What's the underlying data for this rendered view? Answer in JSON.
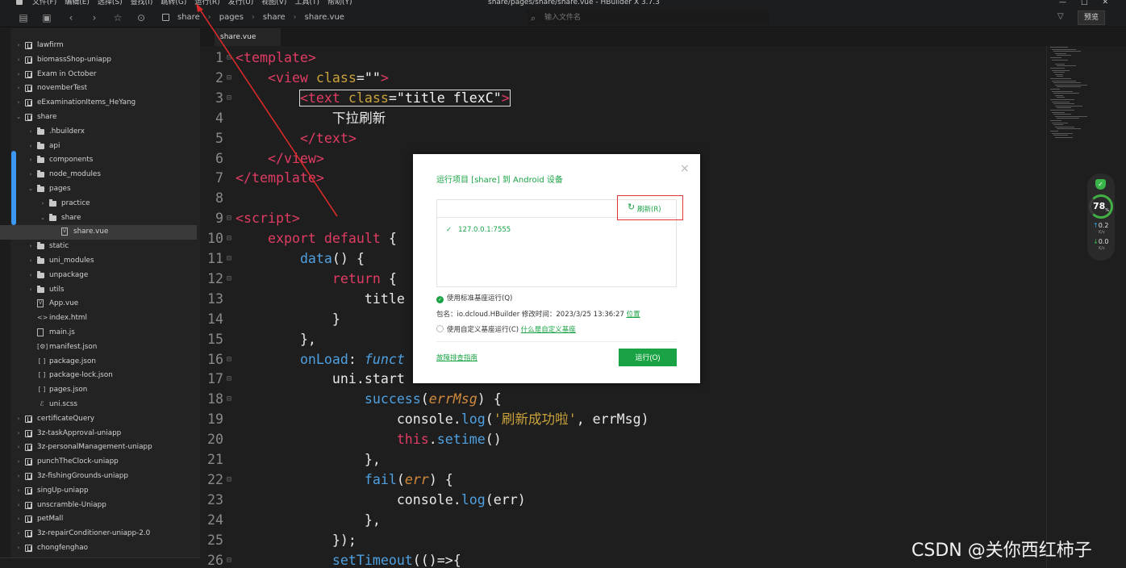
{
  "menubar": {
    "menus": [
      "文件(F)",
      "编辑(E)",
      "选择(S)",
      "查找(I)",
      "跳转(G)",
      "运行(R)",
      "发行(U)",
      "视图(V)",
      "工具(T)",
      "帮助(Y)"
    ],
    "window_title": "share/pages/share/share.vue - HBuilder X 3.7.3",
    "minimize": "—",
    "maximize": "□",
    "close": "✕"
  },
  "toolbar": {
    "breadcrumbs": [
      "share",
      "pages",
      "share",
      "share.vue"
    ],
    "search_placeholder": "输入文件名",
    "preview_label": "预览"
  },
  "sidebar": {
    "items": [
      {
        "label": "lawfirm",
        "depth": 0,
        "type": "project",
        "expanded": false
      },
      {
        "label": "biomassShop-uniapp",
        "depth": 0,
        "type": "project",
        "expanded": false
      },
      {
        "label": "Exam in October",
        "depth": 0,
        "type": "project",
        "expanded": false
      },
      {
        "label": "novemberTest",
        "depth": 0,
        "type": "project",
        "expanded": false
      },
      {
        "label": "eExaminationItems_HeYang",
        "depth": 0,
        "type": "project",
        "expanded": false
      },
      {
        "label": "share",
        "depth": 0,
        "type": "project",
        "expanded": true
      },
      {
        "label": ".hbuilderx",
        "depth": 1,
        "type": "folder",
        "expanded": false
      },
      {
        "label": "api",
        "depth": 1,
        "type": "folder",
        "expanded": false
      },
      {
        "label": "components",
        "depth": 1,
        "type": "folder",
        "expanded": false
      },
      {
        "label": "node_modules",
        "depth": 1,
        "type": "folder",
        "expanded": false
      },
      {
        "label": "pages",
        "depth": 1,
        "type": "folder",
        "expanded": true
      },
      {
        "label": "practice",
        "depth": 2,
        "type": "folder",
        "expanded": false
      },
      {
        "label": "share",
        "depth": 2,
        "type": "folder",
        "expanded": true
      },
      {
        "label": "share.vue",
        "depth": 3,
        "type": "file",
        "icon": "V",
        "selected": true
      },
      {
        "label": "static",
        "depth": 1,
        "type": "folder",
        "expanded": false
      },
      {
        "label": "uni_modules",
        "depth": 1,
        "type": "folder",
        "expanded": false
      },
      {
        "label": "unpackage",
        "depth": 1,
        "type": "folder",
        "expanded": false
      },
      {
        "label": "utils",
        "depth": 1,
        "type": "folder",
        "expanded": false
      },
      {
        "label": "App.vue",
        "depth": 1,
        "type": "file",
        "icon": "V"
      },
      {
        "label": "index.html",
        "depth": 1,
        "type": "sym",
        "icon": "<>"
      },
      {
        "label": "main.js",
        "depth": 1,
        "type": "file",
        "icon": ""
      },
      {
        "label": "manifest.json",
        "depth": 1,
        "type": "sym",
        "icon": "[⚙]"
      },
      {
        "label": "package.json",
        "depth": 1,
        "type": "sym",
        "icon": "[ ]"
      },
      {
        "label": "package-lock.json",
        "depth": 1,
        "type": "sym",
        "icon": "[ ]"
      },
      {
        "label": "pages.json",
        "depth": 1,
        "type": "sym",
        "icon": "[ ]"
      },
      {
        "label": "uni.scss",
        "depth": 1,
        "type": "sym",
        "icon": "ℰ"
      },
      {
        "label": "certificateQuery",
        "depth": 0,
        "type": "project",
        "expanded": false
      },
      {
        "label": "3z-taskApproval-uniapp",
        "depth": 0,
        "type": "project",
        "expanded": false
      },
      {
        "label": "3z-personalManagement-uniapp",
        "depth": 0,
        "type": "project",
        "expanded": false
      },
      {
        "label": "punchTheClock-uniapp",
        "depth": 0,
        "type": "project",
        "expanded": false
      },
      {
        "label": "3z-fishingGrounds-uniapp",
        "depth": 0,
        "type": "project",
        "expanded": false
      },
      {
        "label": "singUp-uniapp",
        "depth": 0,
        "type": "project",
        "expanded": false
      },
      {
        "label": "unscramble-Uniapp",
        "depth": 0,
        "type": "project",
        "expanded": false
      },
      {
        "label": "petMall",
        "depth": 0,
        "type": "project",
        "expanded": false
      },
      {
        "label": "3z-repairConditioner-uniapp-2.0",
        "depth": 0,
        "type": "project",
        "expanded": false
      },
      {
        "label": "chongfenghao",
        "depth": 0,
        "type": "project",
        "expanded": false
      }
    ]
  },
  "editor": {
    "tab_label": "share.vue",
    "lines": [
      {
        "n": "1",
        "fold": true,
        "tokens": [
          [
            "tag",
            "<template>"
          ]
        ]
      },
      {
        "n": "2",
        "fold": true,
        "tokens": [
          [
            "sp",
            "    "
          ],
          [
            "tag",
            "<view"
          ],
          [
            "cn",
            " "
          ],
          [
            "att",
            "class"
          ],
          [
            "cn",
            "="
          ],
          [
            "str",
            "\"\""
          ],
          [
            "tag",
            ">"
          ]
        ]
      },
      {
        "n": "3",
        "fold": true,
        "tokens": [
          [
            "sp",
            "        "
          ],
          [
            "tag",
            "<text"
          ],
          [
            "cn",
            " "
          ],
          [
            "att",
            "class"
          ],
          [
            "cn",
            "="
          ],
          [
            "str",
            "\"title flexC\""
          ],
          [
            "tag",
            ">"
          ]
        ]
      },
      {
        "n": "4",
        "fold": false,
        "tokens": [
          [
            "sp",
            "            "
          ],
          [
            "cn",
            "下拉刷新"
          ]
        ]
      },
      {
        "n": "5",
        "fold": false,
        "tokens": [
          [
            "sp",
            "        "
          ],
          [
            "tag",
            "</text>"
          ]
        ]
      },
      {
        "n": "6",
        "fold": false,
        "tokens": [
          [
            "sp",
            "    "
          ],
          [
            "tag",
            "</view>"
          ]
        ]
      },
      {
        "n": "7",
        "fold": false,
        "tokens": [
          [
            "tag",
            "</template>"
          ]
        ]
      },
      {
        "n": "8",
        "fold": false,
        "tokens": []
      },
      {
        "n": "9",
        "fold": true,
        "tokens": [
          [
            "tag",
            "<script>"
          ]
        ]
      },
      {
        "n": "10",
        "fold": true,
        "tokens": [
          [
            "sp",
            "    "
          ],
          [
            "kw",
            "export default"
          ],
          [
            "cn",
            " {"
          ]
        ]
      },
      {
        "n": "11",
        "fold": true,
        "tokens": [
          [
            "sp",
            "        "
          ],
          [
            "fn",
            "data"
          ],
          [
            "cn",
            "() {"
          ]
        ]
      },
      {
        "n": "12",
        "fold": true,
        "tokens": [
          [
            "sp",
            "            "
          ],
          [
            "kw",
            "return"
          ],
          [
            "cn",
            " {"
          ]
        ]
      },
      {
        "n": "13",
        "fold": false,
        "tokens": [
          [
            "sp",
            "                "
          ],
          [
            "cn",
            "title"
          ]
        ]
      },
      {
        "n": "14",
        "fold": false,
        "tokens": [
          [
            "sp",
            "            "
          ],
          [
            "cn",
            "}"
          ]
        ]
      },
      {
        "n": "15",
        "fold": false,
        "tokens": [
          [
            "sp",
            "        "
          ],
          [
            "cn",
            "},"
          ]
        ]
      },
      {
        "n": "16",
        "fold": true,
        "tokens": [
          [
            "sp",
            "        "
          ],
          [
            "fn",
            "onLoad"
          ],
          [
            "cn",
            ": "
          ],
          [
            "ital",
            "funct"
          ]
        ]
      },
      {
        "n": "17",
        "fold": true,
        "tokens": [
          [
            "sp",
            "            "
          ],
          [
            "cn",
            "uni.start"
          ]
        ]
      },
      {
        "n": "18",
        "fold": true,
        "tokens": [
          [
            "sp",
            "                "
          ],
          [
            "fn",
            "success"
          ],
          [
            "cn",
            "("
          ],
          [
            "prm",
            "errMsg"
          ],
          [
            "cn",
            ") {"
          ]
        ]
      },
      {
        "n": "19",
        "fold": false,
        "tokens": [
          [
            "sp",
            "                    "
          ],
          [
            "cn",
            "console."
          ],
          [
            "fn",
            "log"
          ],
          [
            "cn",
            "("
          ],
          [
            "att",
            "'刷新成功啦'"
          ],
          [
            "cn",
            ", errMsg)"
          ]
        ]
      },
      {
        "n": "20",
        "fold": false,
        "tokens": [
          [
            "sp",
            "                    "
          ],
          [
            "kw",
            "this"
          ],
          [
            "cn",
            "."
          ],
          [
            "fn",
            "setime"
          ],
          [
            "cn",
            "()"
          ]
        ]
      },
      {
        "n": "21",
        "fold": false,
        "tokens": [
          [
            "sp",
            "                "
          ],
          [
            "cn",
            "},"
          ]
        ]
      },
      {
        "n": "22",
        "fold": true,
        "tokens": [
          [
            "sp",
            "                "
          ],
          [
            "fn",
            "fail"
          ],
          [
            "cn",
            "("
          ],
          [
            "prm",
            "err"
          ],
          [
            "cn",
            ") {"
          ]
        ]
      },
      {
        "n": "23",
        "fold": false,
        "tokens": [
          [
            "sp",
            "                    "
          ],
          [
            "cn",
            "console."
          ],
          [
            "fn",
            "log"
          ],
          [
            "cn",
            "(err)"
          ]
        ]
      },
      {
        "n": "24",
        "fold": false,
        "tokens": [
          [
            "sp",
            "                "
          ],
          [
            "cn",
            "},"
          ]
        ]
      },
      {
        "n": "25",
        "fold": false,
        "tokens": [
          [
            "sp",
            "            "
          ],
          [
            "cn",
            "});"
          ]
        ]
      },
      {
        "n": "26",
        "fold": true,
        "tokens": [
          [
            "sp",
            "            "
          ],
          [
            "fn",
            "setTimeout"
          ],
          [
            "cn",
            "(()=>{"
          ]
        ]
      }
    ]
  },
  "perf": {
    "score": "78",
    "score_unit": "%",
    "up_value": "0.2",
    "up_unit": "K/s",
    "down_value": "0.0",
    "down_unit": "K/s"
  },
  "dialog": {
    "title": "运行项目 [share] 到 Android 设备",
    "close": "×",
    "refresh_label": "刷新(R)",
    "device": "127.0.0.1:7555",
    "option_standard": "使用标准基座运行(Q)",
    "package_info": "包名：io.dcloud.HBuilder  修改时间：2023/3/25 13:36:27",
    "package_link": "位置",
    "option_custom": "使用自定义基座运行(C)",
    "custom_link": "什么是自定义基座",
    "troubleshoot_link": "故障排查指南",
    "run_button": "运行(O)"
  },
  "watermark": "CSDN @关你西红柿子",
  "colors": {
    "accent_green": "#1aa345",
    "annotation_red": "#e23434",
    "selection_blue": "#3c97f2"
  }
}
